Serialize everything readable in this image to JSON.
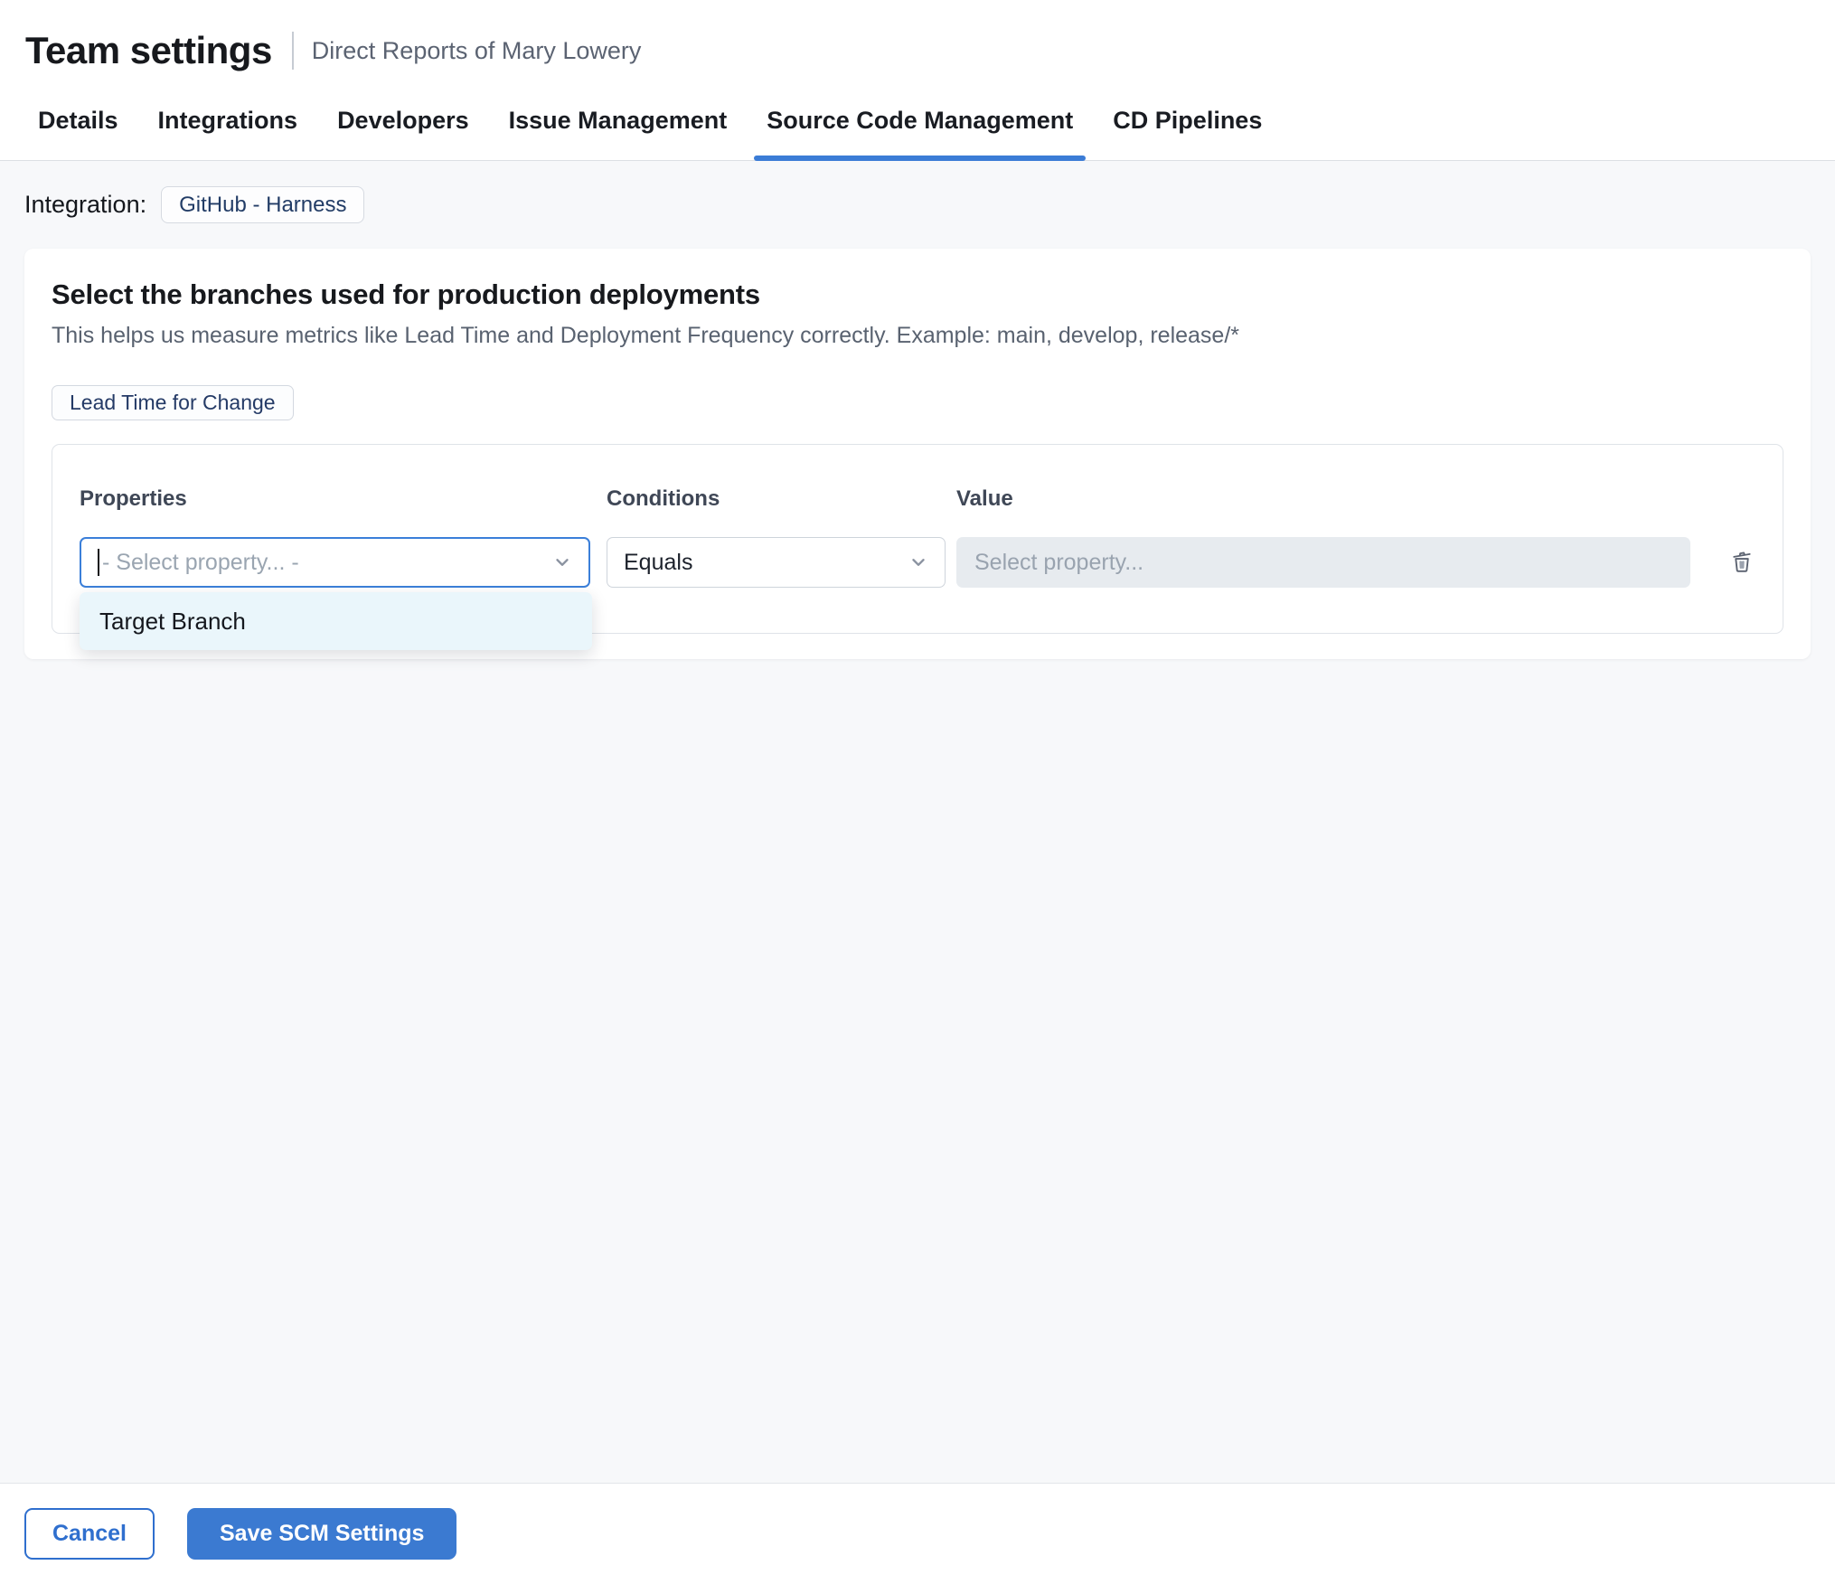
{
  "header": {
    "title": "Team settings",
    "subtitle": "Direct Reports of Mary Lowery"
  },
  "tabs": [
    {
      "label": "Details",
      "active": false
    },
    {
      "label": "Integrations",
      "active": false
    },
    {
      "label": "Developers",
      "active": false
    },
    {
      "label": "Issue Management",
      "active": false
    },
    {
      "label": "Source Code Management",
      "active": true
    },
    {
      "label": "CD Pipelines",
      "active": false
    }
  ],
  "integration": {
    "label": "Integration:",
    "value": "GitHub - Harness"
  },
  "card": {
    "title": "Select the branches used for production deployments",
    "description": "This helps us measure metrics like Lead Time and Deployment Frequency correctly. Example: main, develop, release/*",
    "metric_chip": "Lead Time for Change",
    "rule": {
      "columns": [
        "Properties",
        "Conditions",
        "Value"
      ],
      "property_placeholder": "- Select property... -",
      "condition_value": "Equals",
      "value_placeholder": "Select property...",
      "dropdown_options": [
        "Target Branch"
      ]
    }
  },
  "footer": {
    "cancel_label": "Cancel",
    "save_label": "Save SCM Settings"
  },
  "colors": {
    "accent_blue": "#3b7ad1",
    "tab_underline": "#3b7cd6",
    "focused_border": "#3b7fd9",
    "dropdown_bg": "#eaf6fb",
    "chip_text": "#243a66",
    "page_bg": "#f7f8fa"
  }
}
